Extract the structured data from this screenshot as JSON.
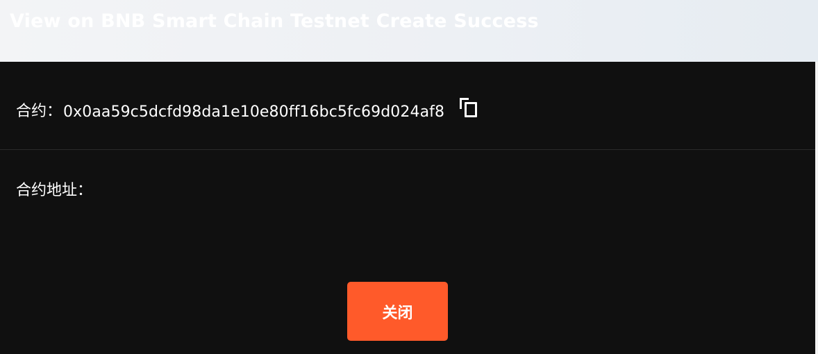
{
  "header": {
    "title": "View on BNB Smart Chain Testnet Create Success"
  },
  "contract": {
    "label": "合约：",
    "value": "0x0aa59c5dcfd98da1e10e80ff16bc5fc69d024af8",
    "copy_icon": "copy-icon"
  },
  "address": {
    "label": "合约地址："
  },
  "actions": {
    "close_label": "关闭"
  },
  "colors": {
    "header_bg": "#eef1f5",
    "modal_bg": "#101010",
    "accent": "#ff5a2a",
    "divider": "#2b2b2b"
  }
}
